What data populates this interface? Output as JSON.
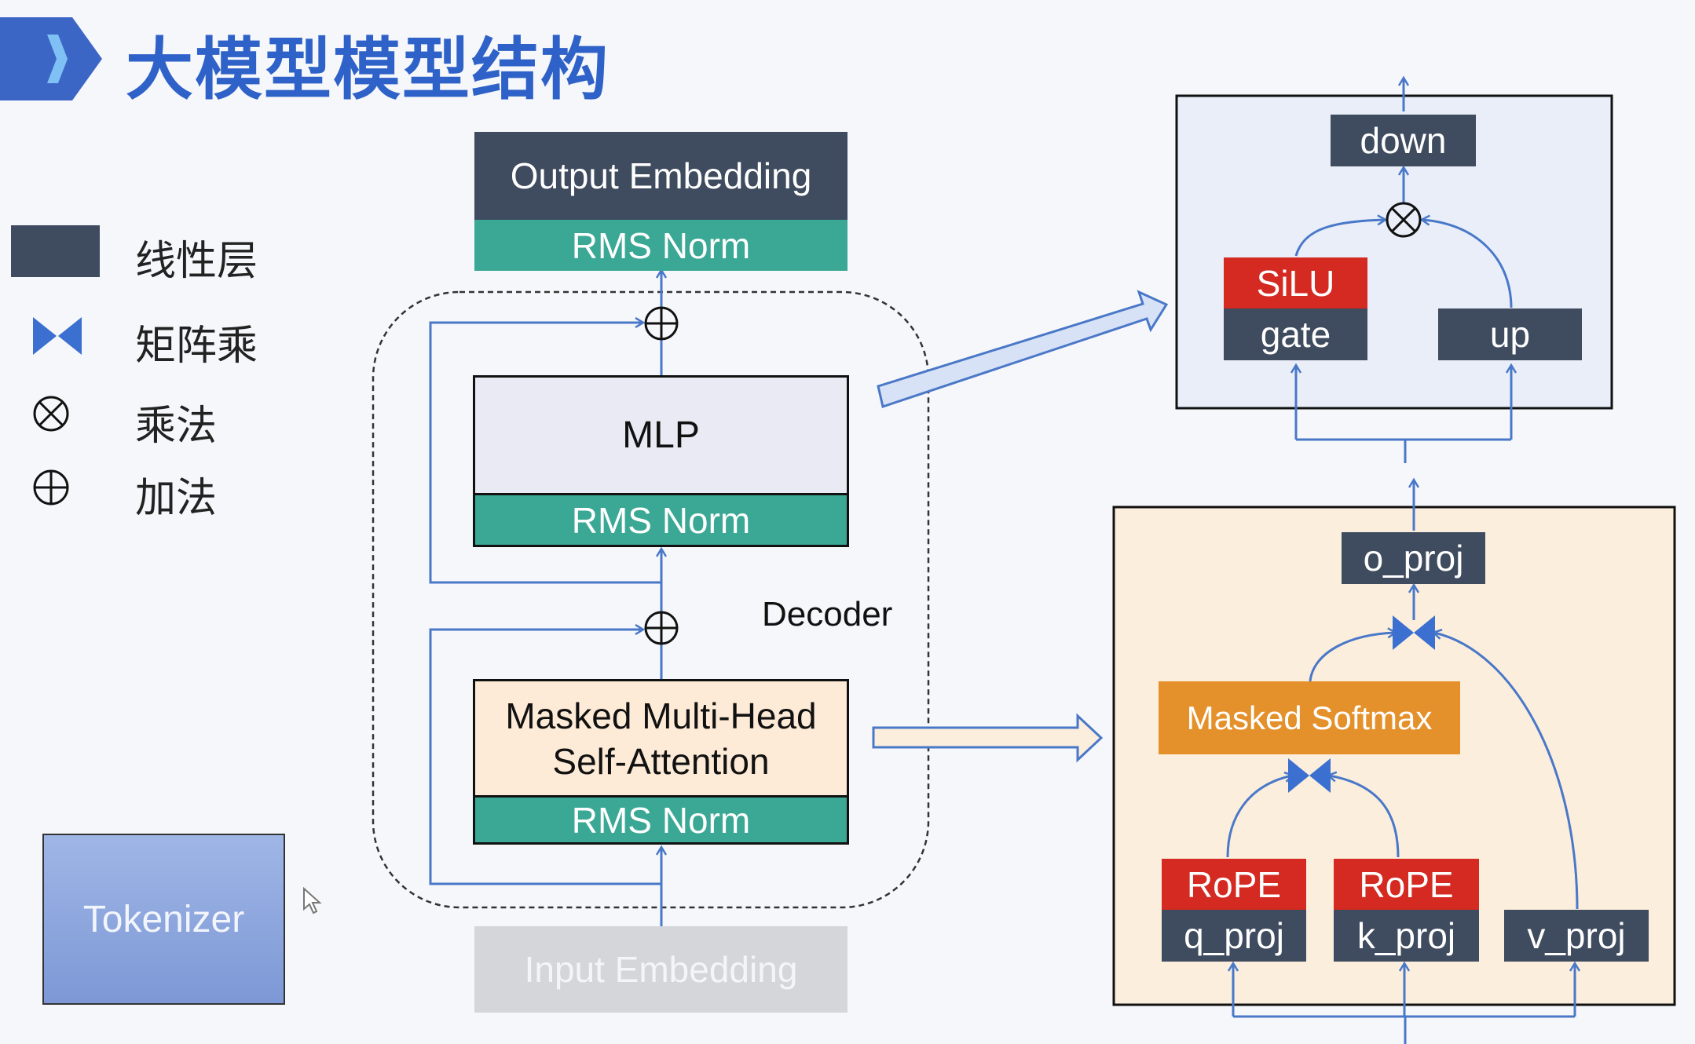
{
  "title": "大模型模型结构",
  "legend": [
    {
      "label": "线性层",
      "icon": "linear-layer-swatch"
    },
    {
      "label": "矩阵乘",
      "icon": "matmul-icon"
    },
    {
      "label": "乘法",
      "icon": "multiply-icon"
    },
    {
      "label": "加法",
      "icon": "add-icon"
    }
  ],
  "main": {
    "output_embedding": "Output Embedding",
    "top_norm": "RMS Norm",
    "mlp": "MLP",
    "mlp_norm": "RMS Norm",
    "decoder": "Decoder",
    "attention_line1": "Masked Multi-Head",
    "attention_line2": "Self-Attention",
    "attention_norm": "RMS Norm",
    "input_embedding": "Input Embedding"
  },
  "tokenizer": "Tokenizer",
  "mlp_detail": {
    "down": "down",
    "silu": "SiLU",
    "gate": "gate",
    "up": "up"
  },
  "attention_detail": {
    "o_proj": "o_proj",
    "softmax": "Masked Softmax",
    "rope_q": "RoPE",
    "rope_k": "RoPE",
    "q_proj": "q_proj",
    "k_proj": "k_proj",
    "v_proj": "v_proj"
  },
  "colors": {
    "title": "#2f62c8",
    "linear": "#3f4b5e",
    "norm": "#3aa894",
    "rope": "#d42a22",
    "softmax": "#e5912b",
    "arrow": "#4a78c8",
    "mlp_panel": "#e9eef8",
    "attn_panel": "#fbeedd"
  }
}
